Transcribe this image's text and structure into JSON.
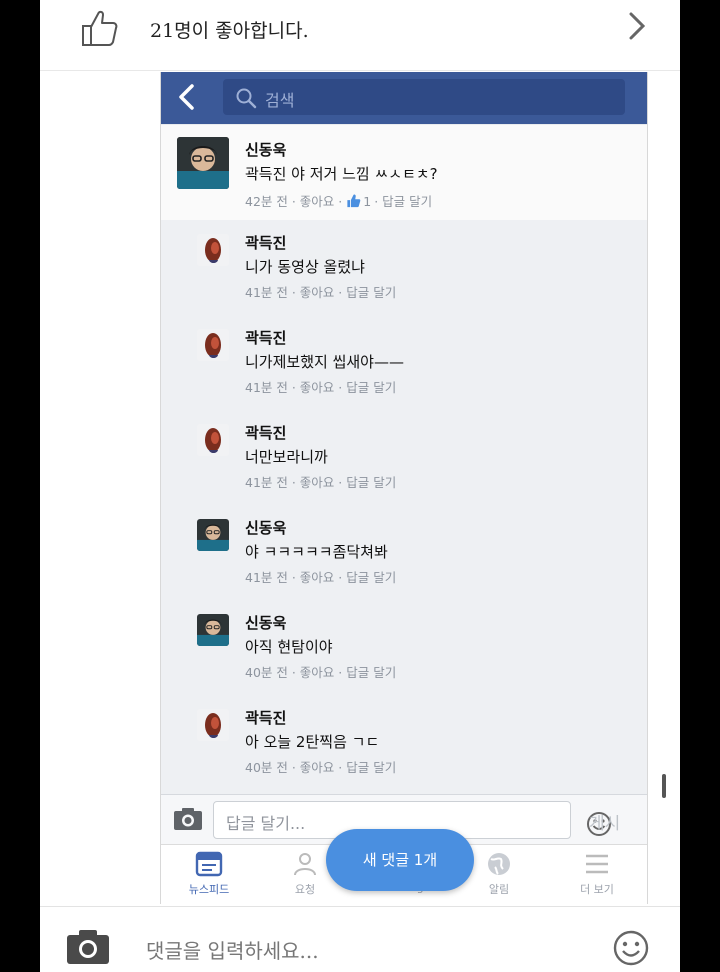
{
  "outer": {
    "likes_text": "21명이 좋아합니다.",
    "comment_placeholder": "댓글을 입력하세요..."
  },
  "phone": {
    "search_placeholder": "검색",
    "comments": [
      {
        "name": "신동욱",
        "text": "곽득진 야 저거 느낌 ㅆㅅㅌㅊ?",
        "meta_before": "42분 전 · 좋아요 ·",
        "like_count": "1",
        "meta_after": "· 답글 달기",
        "avatar": "person"
      },
      {
        "name": "곽득진",
        "text": "니가 동영상 올렸냐",
        "meta": "41분 전 · 좋아요 · 답글 달기",
        "avatar": "red"
      },
      {
        "name": "곽득진",
        "text": "니가제보했지 씹새야——",
        "meta": "41분 전 · 좋아요 · 답글 달기",
        "avatar": "red"
      },
      {
        "name": "곽득진",
        "text": "너만보라니까",
        "meta": "41분 전 · 좋아요 · 답글 달기",
        "avatar": "red"
      },
      {
        "name": "신동욱",
        "text": "야 ㅋㅋㅋㅋㅋ좀닥쳐봐",
        "meta": "41분 전 · 좋아요 · 답글 달기",
        "avatar": "person"
      },
      {
        "name": "신동욱",
        "text": "아직 현탐이야",
        "meta": "40분 전 · 좋아요 · 답글 달기",
        "avatar": "person"
      },
      {
        "name": "곽득진",
        "text": "아 오늘 2탄찍음 ㄱㄷ",
        "meta": "40분 전 · 좋아요 · 답글 달기",
        "avatar": "red"
      }
    ],
    "input_placeholder": "답글 달기...",
    "post_label": "게시",
    "tabs": [
      "뉴스피드",
      "요청",
      "Messenger",
      "알림",
      "더 보기"
    ],
    "new_comment_badge": "새 댓글 1개"
  },
  "colors": {
    "fb_blue": "#3b5998",
    "bubble": "#4a8fe0",
    "meta_gray": "#8d949e"
  }
}
